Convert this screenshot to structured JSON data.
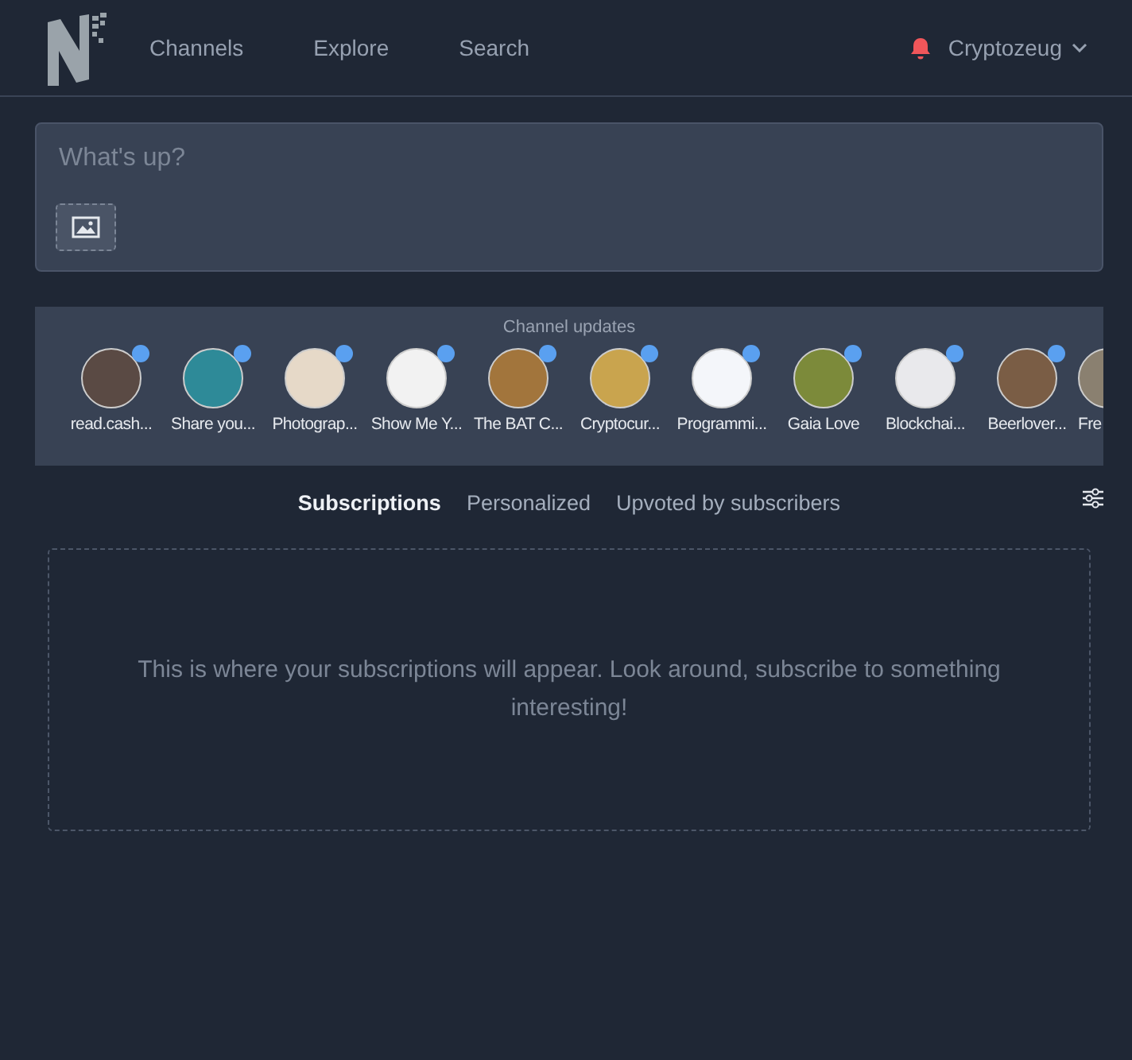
{
  "nav": {
    "links": [
      {
        "label": "Channels"
      },
      {
        "label": "Explore"
      },
      {
        "label": "Search"
      }
    ],
    "user": "Cryptozeug"
  },
  "composer": {
    "placeholder": "What's up?"
  },
  "channel_updates": {
    "title": "Channel updates",
    "channels": [
      {
        "name": "read.cash...",
        "color": "#5a4a44"
      },
      {
        "name": "Share you...",
        "color": "#2e8a98"
      },
      {
        "name": "Photograp...",
        "color": "#e6d9c8"
      },
      {
        "name": "Show Me Y...",
        "color": "#f2f2f2"
      },
      {
        "name": "The BAT C...",
        "color": "#a2753c"
      },
      {
        "name": "Cryptocur...",
        "color": "#c9a44e"
      },
      {
        "name": "Programmi...",
        "color": "#f4f6fa"
      },
      {
        "name": "Gaia Love",
        "color": "#7c8a3a"
      },
      {
        "name": "Blockchai...",
        "color": "#e9e9ec"
      },
      {
        "name": "Beerlover...",
        "color": "#7a5d45"
      },
      {
        "name": "Fre",
        "color": "#8a8070"
      }
    ]
  },
  "feed_tabs": [
    {
      "label": "Subscriptions",
      "selected": true
    },
    {
      "label": "Personalized",
      "selected": false
    },
    {
      "label": "Upvoted by subscribers",
      "selected": false
    }
  ],
  "empty_message": "This is where your subscriptions will appear. Look around, subscribe to something interesting!"
}
